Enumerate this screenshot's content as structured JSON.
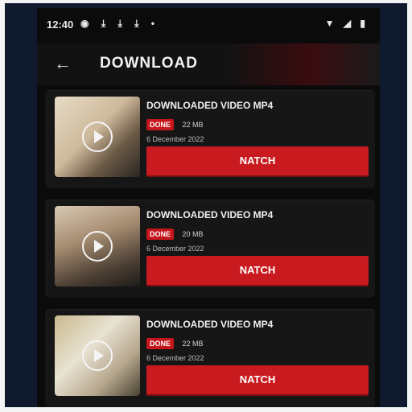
{
  "status_bar": {
    "time": "12:40",
    "left_icons": [
      "location-pin",
      "download",
      "download",
      "download",
      "dot"
    ],
    "right_icons": [
      "wifi",
      "signal",
      "battery"
    ]
  },
  "app_bar": {
    "back_icon": "arrow-left",
    "title": "DOWNLOAD"
  },
  "colors": {
    "background": "#0b0b0b",
    "card": "#161616",
    "accent_red": "#c91a1f",
    "text": "#f0f0f0"
  },
  "downloads": [
    {
      "title": "DOWNLOADED VIDEO MP4",
      "badge": "DONE",
      "size": "22 MB",
      "date": "6 December 2022",
      "button_label": "NATCH"
    },
    {
      "title": "DOWNLOADED VIDEO MP4",
      "badge": "DONE",
      "size": "20 MB",
      "date": "6 December 2022",
      "button_label": "NATCH"
    },
    {
      "title": "DOWNLOADED VIDEO MP4",
      "badge": "DONE",
      "size": "22 MB",
      "date": "6 December 2022",
      "button_label": "NATCH"
    }
  ]
}
